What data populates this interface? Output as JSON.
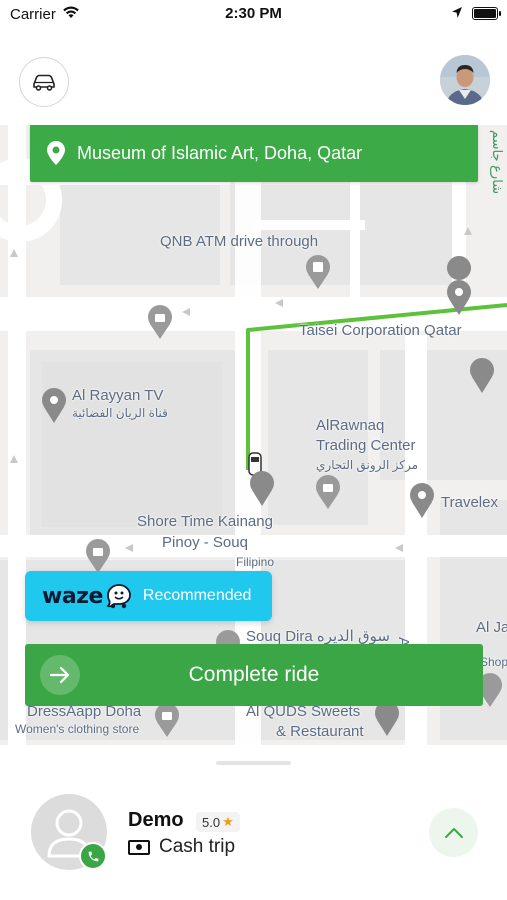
{
  "status_bar": {
    "carrier": "Carrier",
    "time": "2:30 PM"
  },
  "header": {
    "car_icon": "car-icon",
    "profile_icon": "profile-photo"
  },
  "destination": {
    "icon": "location-pin-icon",
    "address": "Museum of Islamic Art, Doha, Qatar",
    "color": "#3daa48"
  },
  "map": {
    "labels": {
      "qnb": "QNB ATM drive through",
      "taisei": "Taisei Corporation Qatar",
      "rayyan_en": "Al Rayyan TV",
      "rayyan_ar": "قناة الريان الفضائية",
      "rawnaq_1": "AlRawnaq",
      "rawnaq_2": "Trading Center",
      "rawnaq_ar": "مركز الرونق التجاري",
      "travelex": "Travelex",
      "shore_1": "Shore Time Kainang",
      "shore_2": "Pinoy - Souq",
      "filipino": "Filipino",
      "souq_dira": "Souq Dira سوق الديره",
      "al_ja": "Al Ja",
      "al_j": "Al J",
      "shop": "Shop",
      "dressapp": "DressAapp Doha",
      "womens": "Women's clothing store",
      "quds_1": "Al QUDS Sweets",
      "quds_2": "& Restaurant"
    },
    "route_color": "#5cc23c"
  },
  "waze": {
    "brand": "waze",
    "label": "Recommended",
    "color": "#21c8ee"
  },
  "complete_ride": {
    "label": "Complete ride",
    "icon": "arrow-right-icon"
  },
  "rider": {
    "name": "Demo",
    "rating": "5.0",
    "payment": "Cash trip",
    "payment_icon": "cash-icon",
    "call_icon": "phone-icon",
    "expand_icon": "chevron-up-icon"
  }
}
